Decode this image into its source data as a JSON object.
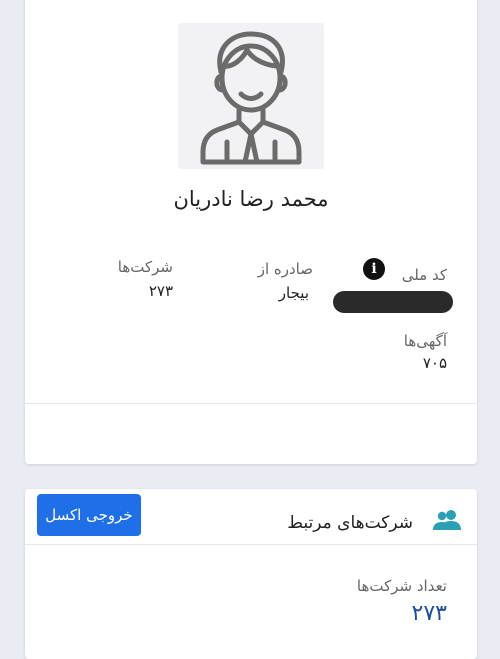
{
  "profile": {
    "name": "محمد رضا نادریان",
    "avatar_icon": "user-avatar-icon",
    "national_code_label": "کد ملی",
    "issued_from_label": "صادره از",
    "issued_from_value": "بیجار",
    "companies_label": "شرکت‌ها",
    "companies_value": "۲۷۳",
    "ads_label": "آگهی‌ها",
    "ads_value": "۷۰۵"
  },
  "related_companies": {
    "title": "شرکت‌های مرتبط",
    "export_button": "خروجی اکسل",
    "count_label": "تعداد شرکت‌ها",
    "count_value": "۲۷۳"
  },
  "colors": {
    "accent": "#1f6fe8",
    "icon_teal": "#2b9fb4",
    "count_blue": "#1a4fa0"
  }
}
